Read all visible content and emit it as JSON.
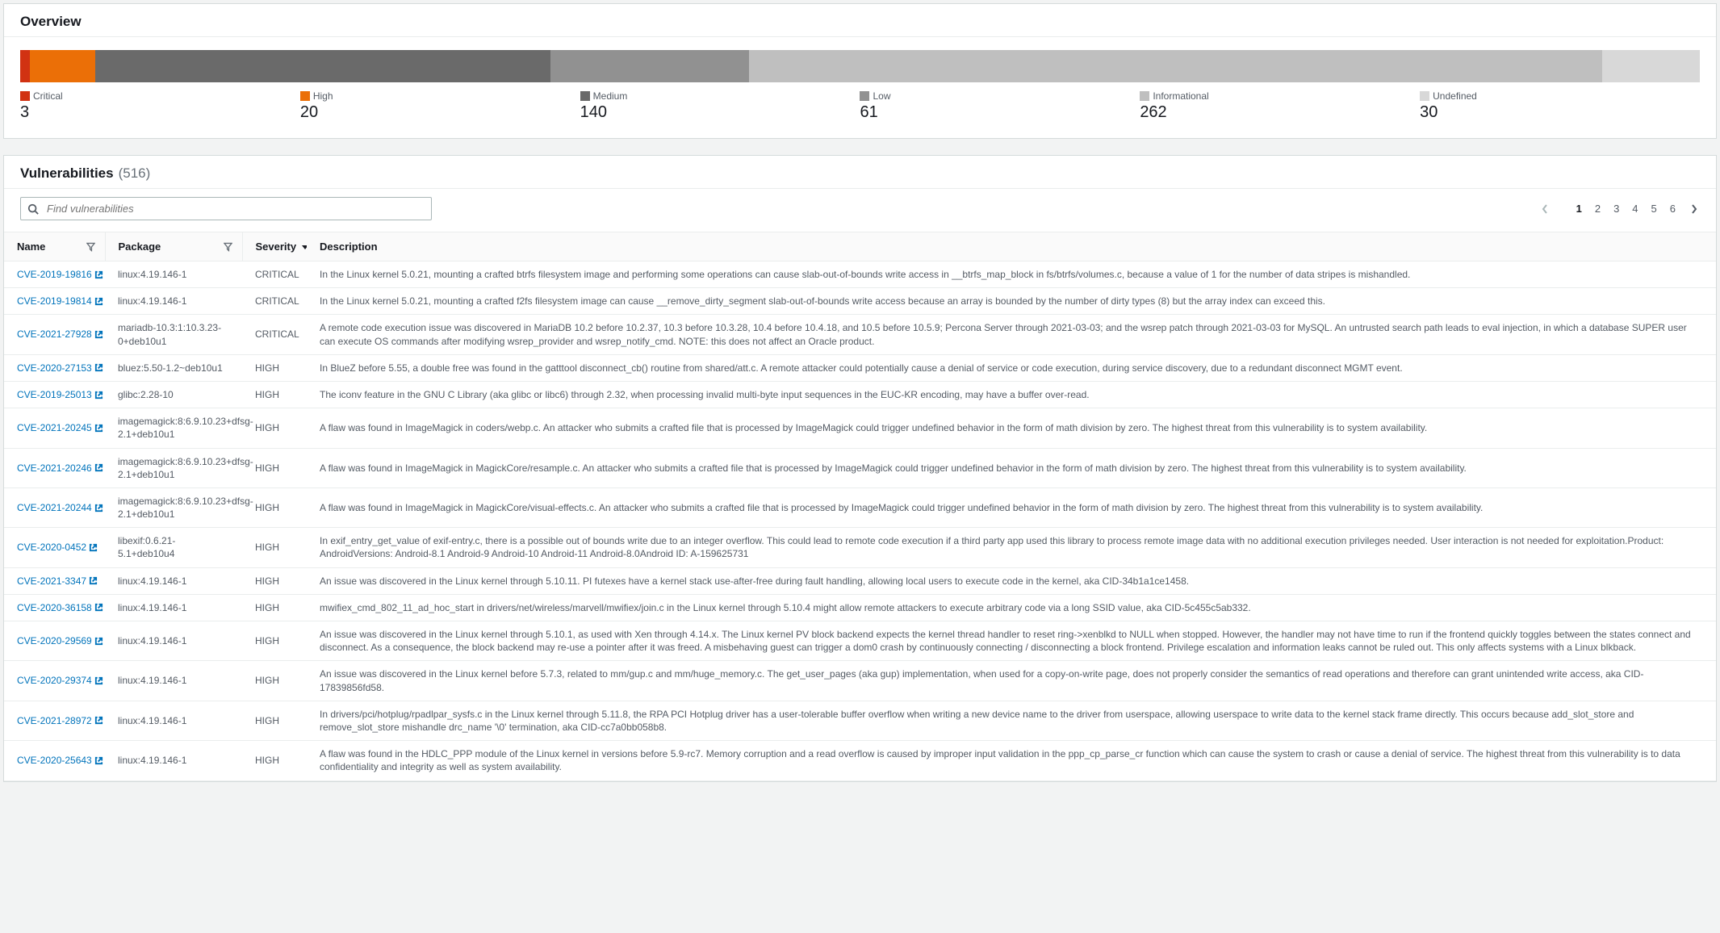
{
  "overview": {
    "title": "Overview",
    "segments": [
      {
        "label": "Critical",
        "count": 3,
        "color": "#d13212",
        "cls": "bar-critical"
      },
      {
        "label": "High",
        "count": 20,
        "color": "#eb6f07",
        "cls": "bar-high"
      },
      {
        "label": "Medium",
        "count": 140,
        "color": "#6a6a6a",
        "cls": "bar-medium"
      },
      {
        "label": "Low",
        "count": 61,
        "color": "#919191",
        "cls": "bar-low"
      },
      {
        "label": "Informational",
        "count": 262,
        "color": "#bfbfbf",
        "cls": "bar-info"
      },
      {
        "label": "Undefined",
        "count": 30,
        "color": "#d8d8d8",
        "cls": "bar-undef"
      }
    ]
  },
  "vulnerabilities": {
    "title": "Vulnerabilities",
    "total": "(516)",
    "search_placeholder": "Find vulnerabilities",
    "columns": {
      "name": "Name",
      "package": "Package",
      "severity": "Severity",
      "description": "Description"
    },
    "pagination": {
      "pages": [
        "1",
        "2",
        "3",
        "4",
        "5",
        "6"
      ],
      "current": "1"
    },
    "rows": [
      {
        "cve": "CVE-2019-19816",
        "pkg": "linux:4.19.146-1",
        "sev": "CRITICAL",
        "desc": "In the Linux kernel 5.0.21, mounting a crafted btrfs filesystem image and performing some operations can cause slab-out-of-bounds write access in __btrfs_map_block in fs/btrfs/volumes.c, because a value of 1 for the number of data stripes is mishandled."
      },
      {
        "cve": "CVE-2019-19814",
        "pkg": "linux:4.19.146-1",
        "sev": "CRITICAL",
        "desc": "In the Linux kernel 5.0.21, mounting a crafted f2fs filesystem image can cause __remove_dirty_segment slab-out-of-bounds write access because an array is bounded by the number of dirty types (8) but the array index can exceed this."
      },
      {
        "cve": "CVE-2021-27928",
        "pkg": "mariadb-10.3:1:10.3.23-0+deb10u1",
        "sev": "CRITICAL",
        "desc": "A remote code execution issue was discovered in MariaDB 10.2 before 10.2.37, 10.3 before 10.3.28, 10.4 before 10.4.18, and 10.5 before 10.5.9; Percona Server through 2021-03-03; and the wsrep patch through 2021-03-03 for MySQL. An untrusted search path leads to eval injection, in which a database SUPER user can execute OS commands after modifying wsrep_provider and wsrep_notify_cmd. NOTE: this does not affect an Oracle product."
      },
      {
        "cve": "CVE-2020-27153",
        "pkg": "bluez:5.50-1.2~deb10u1",
        "sev": "HIGH",
        "desc": "In BlueZ before 5.55, a double free was found in the gatttool disconnect_cb() routine from shared/att.c. A remote attacker could potentially cause a denial of service or code execution, during service discovery, due to a redundant disconnect MGMT event."
      },
      {
        "cve": "CVE-2019-25013",
        "pkg": "glibc:2.28-10",
        "sev": "HIGH",
        "desc": "The iconv feature in the GNU C Library (aka glibc or libc6) through 2.32, when processing invalid multi-byte input sequences in the EUC-KR encoding, may have a buffer over-read."
      },
      {
        "cve": "CVE-2021-20245",
        "pkg": "imagemagick:8:6.9.10.23+dfsg-2.1+deb10u1",
        "sev": "HIGH",
        "desc": "A flaw was found in ImageMagick in coders/webp.c. An attacker who submits a crafted file that is processed by ImageMagick could trigger undefined behavior in the form of math division by zero. The highest threat from this vulnerability is to system availability."
      },
      {
        "cve": "CVE-2021-20246",
        "pkg": "imagemagick:8:6.9.10.23+dfsg-2.1+deb10u1",
        "sev": "HIGH",
        "desc": "A flaw was found in ImageMagick in MagickCore/resample.c. An attacker who submits a crafted file that is processed by ImageMagick could trigger undefined behavior in the form of math division by zero. The highest threat from this vulnerability is to system availability."
      },
      {
        "cve": "CVE-2021-20244",
        "pkg": "imagemagick:8:6.9.10.23+dfsg-2.1+deb10u1",
        "sev": "HIGH",
        "desc": "A flaw was found in ImageMagick in MagickCore/visual-effects.c. An attacker who submits a crafted file that is processed by ImageMagick could trigger undefined behavior in the form of math division by zero. The highest threat from this vulnerability is to system availability."
      },
      {
        "cve": "CVE-2020-0452",
        "pkg": "libexif:0.6.21-5.1+deb10u4",
        "sev": "HIGH",
        "desc": "In exif_entry_get_value of exif-entry.c, there is a possible out of bounds write due to an integer overflow. This could lead to remote code execution if a third party app used this library to process remote image data with no additional execution privileges needed. User interaction is not needed for exploitation.Product: AndroidVersions: Android-8.1 Android-9 Android-10 Android-11 Android-8.0Android ID: A-159625731"
      },
      {
        "cve": "CVE-2021-3347",
        "pkg": "linux:4.19.146-1",
        "sev": "HIGH",
        "desc": "An issue was discovered in the Linux kernel through 5.10.11. PI futexes have a kernel stack use-after-free during fault handling, allowing local users to execute code in the kernel, aka CID-34b1a1ce1458."
      },
      {
        "cve": "CVE-2020-36158",
        "pkg": "linux:4.19.146-1",
        "sev": "HIGH",
        "desc": "mwifiex_cmd_802_11_ad_hoc_start in drivers/net/wireless/marvell/mwifiex/join.c in the Linux kernel through 5.10.4 might allow remote attackers to execute arbitrary code via a long SSID value, aka CID-5c455c5ab332."
      },
      {
        "cve": "CVE-2020-29569",
        "pkg": "linux:4.19.146-1",
        "sev": "HIGH",
        "desc": "An issue was discovered in the Linux kernel through 5.10.1, as used with Xen through 4.14.x. The Linux kernel PV block backend expects the kernel thread handler to reset ring->xenblkd to NULL when stopped. However, the handler may not have time to run if the frontend quickly toggles between the states connect and disconnect. As a consequence, the block backend may re-use a pointer after it was freed. A misbehaving guest can trigger a dom0 crash by continuously connecting / disconnecting a block frontend. Privilege escalation and information leaks cannot be ruled out. This only affects systems with a Linux blkback."
      },
      {
        "cve": "CVE-2020-29374",
        "pkg": "linux:4.19.146-1",
        "sev": "HIGH",
        "desc": "An issue was discovered in the Linux kernel before 5.7.3, related to mm/gup.c and mm/huge_memory.c. The get_user_pages (aka gup) implementation, when used for a copy-on-write page, does not properly consider the semantics of read operations and therefore can grant unintended write access, aka CID-17839856fd58."
      },
      {
        "cve": "CVE-2021-28972",
        "pkg": "linux:4.19.146-1",
        "sev": "HIGH",
        "desc": "In drivers/pci/hotplug/rpadlpar_sysfs.c in the Linux kernel through 5.11.8, the RPA PCI Hotplug driver has a user-tolerable buffer overflow when writing a new device name to the driver from userspace, allowing userspace to write data to the kernel stack frame directly. This occurs because add_slot_store and remove_slot_store mishandle drc_name '\\0' termination, aka CID-cc7a0bb058b8."
      },
      {
        "cve": "CVE-2020-25643",
        "pkg": "linux:4.19.146-1",
        "sev": "HIGH",
        "desc": "A flaw was found in the HDLC_PPP module of the Linux kernel in versions before 5.9-rc7. Memory corruption and a read overflow is caused by improper input validation in the ppp_cp_parse_cr function which can cause the system to crash or cause a denial of service. The highest threat from this vulnerability is to data confidentiality and integrity as well as system availability."
      }
    ]
  },
  "chart_data": {
    "type": "bar",
    "title": "Overview",
    "categories": [
      "Critical",
      "High",
      "Medium",
      "Low",
      "Informational",
      "Undefined"
    ],
    "values": [
      3,
      20,
      140,
      61,
      262,
      30
    ],
    "colors": [
      "#d13212",
      "#eb6f07",
      "#6a6a6a",
      "#919191",
      "#bfbfbf",
      "#d8d8d8"
    ],
    "xlabel": "",
    "ylabel": ""
  }
}
